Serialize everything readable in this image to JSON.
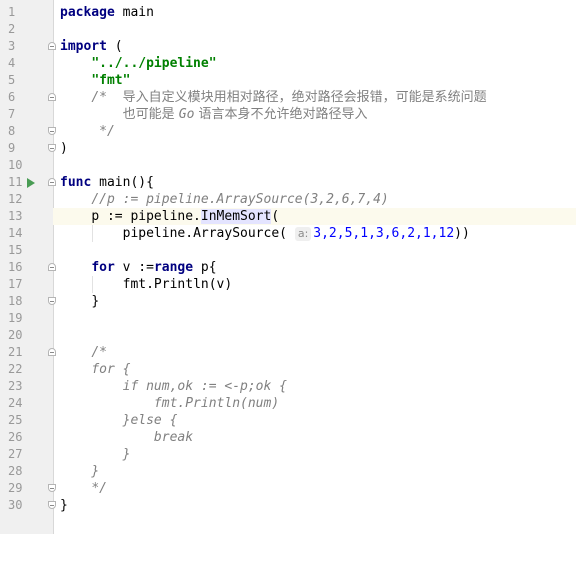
{
  "editor": {
    "language": "Go",
    "line_numbers": [
      "1",
      "2",
      "3",
      "4",
      "5",
      "6",
      "7",
      "8",
      "9",
      "10",
      "11",
      "12",
      "13",
      "14",
      "15",
      "16",
      "17",
      "18",
      "19",
      "20",
      "21",
      "22",
      "23",
      "24",
      "25",
      "26",
      "27",
      "28",
      "29",
      "30"
    ],
    "lines": {
      "l1_kw": "package",
      "l1_rest": " main",
      "l3_kw": "import",
      "l3_rest": " (",
      "l4_str": "\"../../pipeline\"",
      "l5_str": "\"fmt\"",
      "l6_a": "/*  ",
      "l6_b": "导入自定义模块用相对路径，绝对路径会报错，可能是系统问题",
      "l7_a": "",
      "l7_b": "也可能是 ",
      "l7_c": "Go",
      "l7_d": " 语言本身不允许绝对路径导入",
      "l8": " */",
      "l9": ")",
      "l11_kw": "func",
      "l11_rest": " main(){",
      "l12": "//p := pipeline.ArraySource(3,2,6,7,4)",
      "l13_a": "p := pipeline.",
      "l13_hl": "InMemSort",
      "l13_b": "(",
      "l14_a": "pipeline.ArraySource(",
      "l14_hint": "a:",
      "l14_nums": "3,2,5,1,3,6,2,1,12",
      "l14_b": "))",
      "l16_kw1": "for",
      "l16_a": " v :=",
      "l16_kw2": "range",
      "l16_b": " p{",
      "l17": "fmt.Println(v)",
      "l18": "}",
      "l21": "/*",
      "l22": "for {",
      "l23": "if num,ok := <-p;ok {",
      "l24": "fmt.Println(num)",
      "l25": "}else {",
      "l26": "break",
      "l27": "}",
      "l28": "}",
      "l29": "*/",
      "l30": "}"
    }
  },
  "colors": {
    "keyword": "#000080",
    "string": "#008000",
    "comment": "#808080",
    "number": "#0000ff",
    "current_line": "#fcfaed",
    "run_marker": "#499c54",
    "highlight": "#e4e4ff"
  },
  "icons": [
    "run-gutter-icon",
    "fold-marker-icon"
  ]
}
